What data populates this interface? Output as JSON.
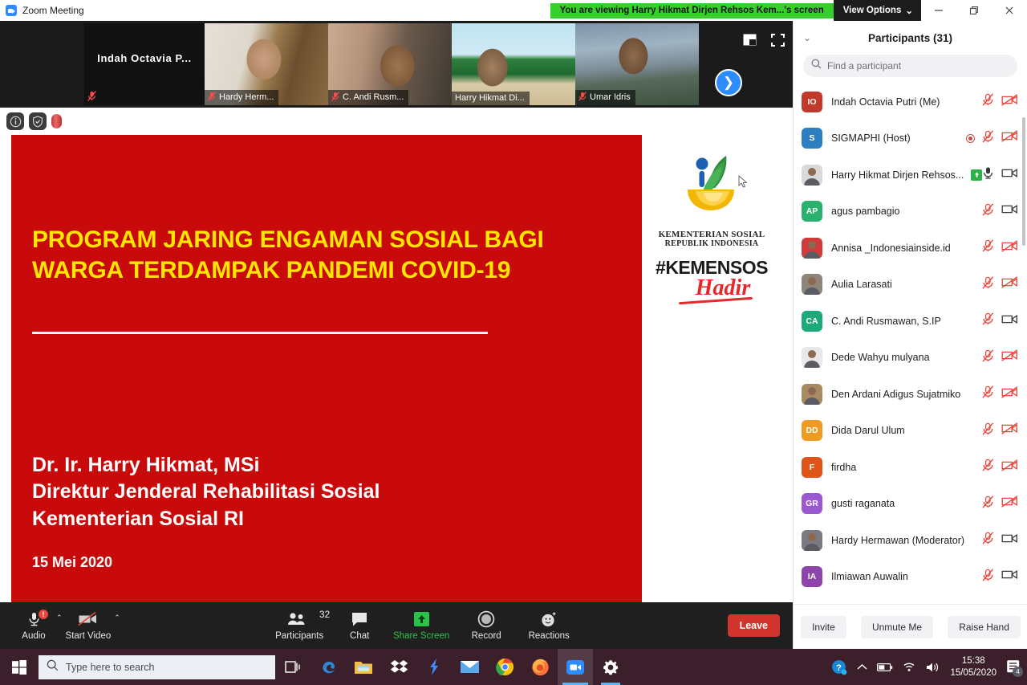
{
  "window": {
    "app_icon": "zoom-icon",
    "title": "Zoom Meeting",
    "viewing_banner": "You are viewing Harry Hikmat Dirjen Rehsos Kem...'s screen",
    "view_options_label": "View Options",
    "minimize_label": "–",
    "restore_label": "❐",
    "close_label": "✕"
  },
  "filmstrip": {
    "self_name": "Indah  Octavia  P...",
    "thumbs": [
      {
        "name": "Hardy Herm...",
        "muted": true,
        "speaking": false
      },
      {
        "name": "C. Andi Rusm...",
        "muted": true,
        "speaking": false
      },
      {
        "name": "Harry Hikmat Di...",
        "muted": false,
        "speaking": true
      },
      {
        "name": "Umar Idris",
        "muted": true,
        "speaking": false
      }
    ],
    "next_label": "❯",
    "minimize_view_icon": "picture-in-picture-icon",
    "fullscreen_icon": "fullscreen-icon"
  },
  "share_toolbar": {
    "info_label": "i",
    "security_icon": "shield-icon",
    "record_icon": "recording-pill-icon"
  },
  "slide": {
    "title_line1": "PROGRAM JARING ENGAMAN SOSIAL BAGI",
    "title_line2": "WARGA TERDAMPAK PANDEMI COVID-19",
    "person_line1": "Dr. Ir. Harry Hikmat, MSi",
    "person_line2": "Direktur Jenderal Rehabilitasi Sosial",
    "person_line3": "Kementerian Sosial RI",
    "date": "15 Mei 2020",
    "logo_caption_line1": "KEMENTERIAN SOSIAL",
    "logo_caption_line2": "REPUBLIK INDONESIA",
    "hashtag_main": "#KEMENSOS",
    "hashtag_sub": "Hadir",
    "colors": {
      "background_red": "#c80a0a",
      "title_yellow": "#ffe500",
      "accent_red": "#e8262b",
      "logo_green": "#2f8a3e",
      "logo_yellow": "#f2b705",
      "logo_blue": "#1d5fb0"
    }
  },
  "zoom_toolbar": {
    "items": [
      {
        "name": "audio",
        "label": "Audio",
        "icon": "microphone-muted-icon",
        "has_caret": true,
        "badge": "!"
      },
      {
        "name": "start-video",
        "label": "Start Video",
        "icon": "camera-off-icon",
        "has_caret": true
      },
      {
        "name": "participants",
        "label": "Participants",
        "icon": "participants-icon",
        "count": "32"
      },
      {
        "name": "chat",
        "label": "Chat",
        "icon": "chat-bubble-icon"
      },
      {
        "name": "share-screen",
        "label": "Share Screen",
        "icon": "share-arrow-up-icon"
      },
      {
        "name": "record",
        "label": "Record",
        "icon": "record-circle-icon"
      },
      {
        "name": "reactions",
        "label": "Reactions",
        "icon": "smiley-reaction-icon"
      }
    ],
    "leave_label": "Leave"
  },
  "participants_panel": {
    "title": "Participants (31)",
    "collapse_icon": "chevron-down-icon",
    "search_placeholder": "Find a participant",
    "search_value": "",
    "list": [
      {
        "name": "Indah Octavia Putri (Me)",
        "initials": "IO",
        "avatar_color": "#c0392b",
        "photo": false,
        "mic": "off",
        "cam": "off",
        "recording": false,
        "sharing": false
      },
      {
        "name": "SIGMAPHI (Host)",
        "initials": "S",
        "avatar_color": "#2d7fc1",
        "photo": false,
        "mic": "off",
        "cam": "off",
        "recording": true,
        "sharing": false
      },
      {
        "name": "Harry Hikmat Dirjen Rehsos...",
        "initials": "",
        "avatar_color": "#d9d9d9",
        "photo": true,
        "mic": "on",
        "cam": "on",
        "recording": false,
        "sharing": true
      },
      {
        "name": "agus pambagio",
        "initials": "AP",
        "avatar_color": "#2ab06f",
        "photo": false,
        "mic": "off",
        "cam": "on",
        "recording": false,
        "sharing": false
      },
      {
        "name": "Annisa _Indonesiainside.id",
        "initials": "",
        "avatar_color": "#d23b3b",
        "photo": true,
        "mic": "off",
        "cam": "off",
        "recording": false,
        "sharing": false
      },
      {
        "name": "Aulia Larasati",
        "initials": "",
        "avatar_color": "#8c8578",
        "photo": true,
        "mic": "off",
        "cam": "off",
        "recording": false,
        "sharing": false
      },
      {
        "name": "C. Andi Rusmawan, S.IP",
        "initials": "CA",
        "avatar_color": "#1ea97c",
        "photo": false,
        "mic": "off",
        "cam": "on",
        "recording": false,
        "sharing": false
      },
      {
        "name": "Dede Wahyu mulyana",
        "initials": "",
        "avatar_color": "#e8e8ea",
        "photo": true,
        "mic": "off",
        "cam": "off",
        "recording": false,
        "sharing": false
      },
      {
        "name": "Den Ardani Adigus Sujatmiko",
        "initials": "",
        "avatar_color": "#a98b63",
        "photo": true,
        "mic": "off",
        "cam": "off",
        "recording": false,
        "sharing": false
      },
      {
        "name": "Dida Darul Ulum",
        "initials": "DD",
        "avatar_color": "#ef9a22",
        "photo": false,
        "mic": "off",
        "cam": "off",
        "recording": false,
        "sharing": false
      },
      {
        "name": "firdha",
        "initials": "F",
        "avatar_color": "#e0541a",
        "photo": false,
        "mic": "off",
        "cam": "off",
        "recording": false,
        "sharing": false
      },
      {
        "name": "gusti raganata",
        "initials": "GR",
        "avatar_color": "#9b59d0",
        "photo": false,
        "mic": "off",
        "cam": "off",
        "recording": false,
        "sharing": false
      },
      {
        "name": "Hardy Hermawan (Moderator)",
        "initials": "",
        "avatar_color": "#7a7a80",
        "photo": true,
        "mic": "off",
        "cam": "on",
        "recording": false,
        "sharing": false
      },
      {
        "name": "Ilmiawan Auwalin",
        "initials": "IA",
        "avatar_color": "#8e44ad",
        "photo": false,
        "mic": "off",
        "cam": "on",
        "recording": false,
        "sharing": false
      }
    ],
    "footer_buttons": [
      {
        "name": "invite",
        "label": "Invite"
      },
      {
        "name": "unmute-me",
        "label": "Unmute Me"
      },
      {
        "name": "raise-hand",
        "label": "Raise Hand"
      }
    ]
  },
  "taskbar": {
    "start_icon": "windows-start-icon",
    "search_placeholder": "Type here to search",
    "task_view_icon": "task-view-icon",
    "apps": [
      {
        "name": "edge",
        "icon": "edge-icon",
        "glyph": "e",
        "color": "#2c87d4",
        "state": ""
      },
      {
        "name": "file-explorer",
        "icon": "folder-icon",
        "glyph": "🗀",
        "color": "#f3bf4c",
        "state": ""
      },
      {
        "name": "dropbox",
        "icon": "dropbox-icon",
        "glyph": "",
        "color": "#ffffff",
        "state": ""
      },
      {
        "name": "shareit",
        "icon": "lightning-icon",
        "glyph": "⚡",
        "color": "#3d8bf7",
        "state": ""
      },
      {
        "name": "mail",
        "icon": "envelope-icon",
        "glyph": "✉",
        "color": "#2f7fd4",
        "state": ""
      },
      {
        "name": "chrome",
        "icon": "chrome-icon",
        "glyph": "",
        "color": "#4285f4",
        "state": ""
      },
      {
        "name": "firefox",
        "icon": "firefox-icon",
        "glyph": "",
        "color": "#ff7139",
        "state": ""
      },
      {
        "name": "zoom",
        "icon": "zoom-video-icon",
        "glyph": "",
        "color": "#2d8cff",
        "state": "active"
      },
      {
        "name": "settings",
        "icon": "gear-icon",
        "glyph": "⚙",
        "color": "#ffffff",
        "state": "open"
      }
    ],
    "tray": {
      "help_icon": "help-question-icon",
      "chevron_icon": "show-hidden-icons-icon",
      "battery_icon": "battery-icon",
      "wifi_icon": "wifi-icon",
      "volume_icon": "speaker-icon",
      "time": "15:38",
      "date": "15/05/2020",
      "notification_icon": "action-center-icon",
      "notification_count": "4"
    }
  }
}
